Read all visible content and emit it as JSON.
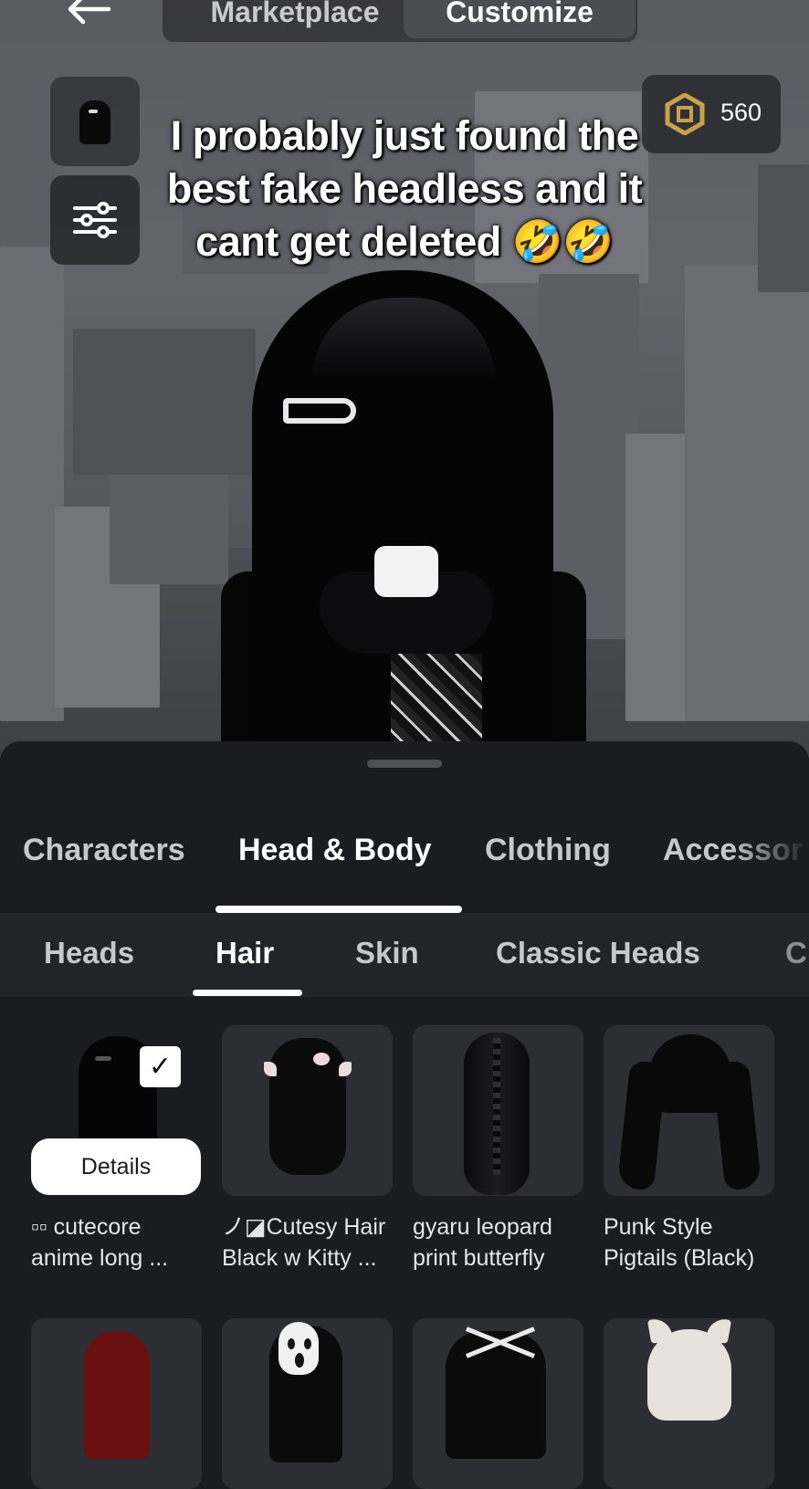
{
  "top_bar": {
    "back_icon": "arrow-left-icon",
    "tabs": [
      {
        "label": "Marketplace",
        "active": false
      },
      {
        "label": "Customize",
        "active": true
      }
    ]
  },
  "robux": {
    "icon": "robux-hexagon-icon",
    "amount": "560",
    "color": "#c7a24a"
  },
  "overlay_caption": {
    "lines": [
      "I probably just found the",
      "best fake headless and it",
      "cant get deleted 🤣🤣"
    ]
  },
  "category_tabs": [
    {
      "label": "Characters",
      "active": false
    },
    {
      "label": "Head & Body",
      "active": true
    },
    {
      "label": "Clothing",
      "active": false
    },
    {
      "label": "Accessor",
      "active": false
    }
  ],
  "sub_tabs": [
    {
      "label": "Heads",
      "active": false
    },
    {
      "label": "Hair",
      "active": true
    },
    {
      "label": "Skin",
      "active": false
    },
    {
      "label": "Classic Heads",
      "active": false
    },
    {
      "label": "C",
      "active": false
    }
  ],
  "items": [
    {
      "name_line1": "▫▫ cutecore",
      "name_line2": "anime long ...",
      "selected": true,
      "details_label": "Details"
    },
    {
      "name_line1": "ノ◪Cutesy Hair",
      "name_line2": "Black w Kitty ...",
      "selected": false
    },
    {
      "name_line1": "gyaru leopard",
      "name_line2": "print butterfly",
      "selected": false
    },
    {
      "name_line1": "Punk Style",
      "name_line2": "Pigtails (Black)",
      "selected": false
    }
  ],
  "colors": {
    "accent": "#ffffff",
    "sheet_bg": "#1b1c20",
    "thumb_bg": "#2d2e33"
  }
}
